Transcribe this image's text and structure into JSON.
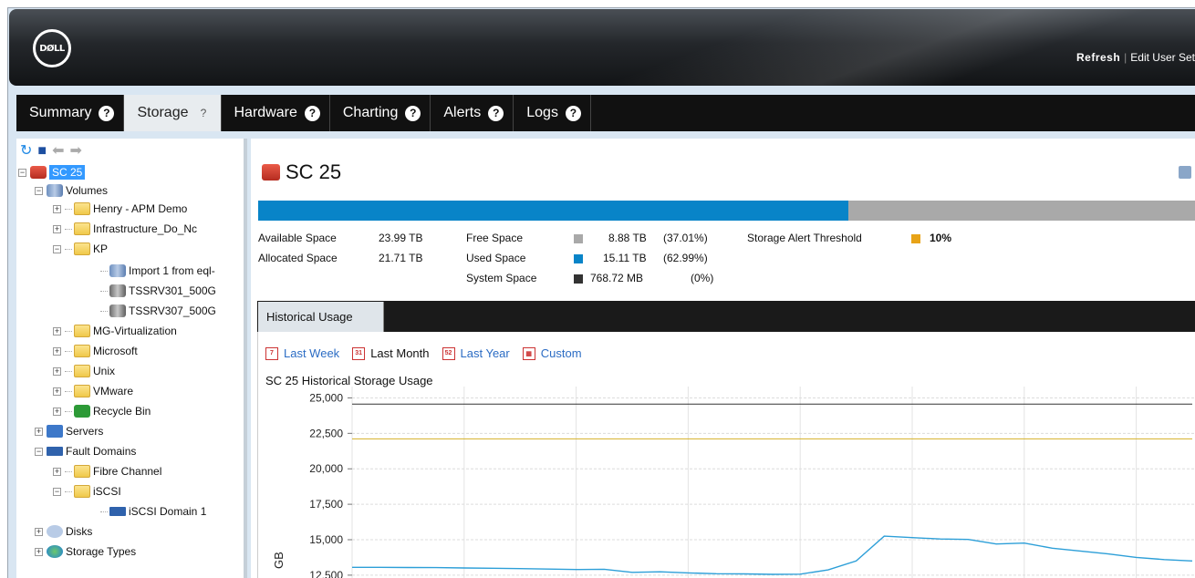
{
  "header": {
    "logo_text": "DØLL",
    "links": [
      "Refresh",
      "Edit User Set"
    ]
  },
  "tabs": [
    {
      "label": "Summary"
    },
    {
      "label": "Storage"
    },
    {
      "label": "Hardware"
    },
    {
      "label": "Charting"
    },
    {
      "label": "Alerts"
    },
    {
      "label": "Logs"
    }
  ],
  "tree": {
    "root": "SC 25",
    "volumes": "Volumes",
    "henry": "Henry - APM Demo",
    "infra": "Infrastructure_Do_Nc",
    "kp": "KP",
    "import": "Import 1 from eql-",
    "tssrv301": "TSSRV301_500G",
    "tssrv307": "TSSRV307_500G",
    "mgvirt": "MG-Virtualization",
    "microsoft": "Microsoft",
    "unix": "Unix",
    "vmware": "VMware",
    "recycle": "Recycle Bin",
    "servers": "Servers",
    "fault": "Fault Domains",
    "fibre": "Fibre Channel",
    "iscsi": "iSCSI",
    "iscsidom": "iSCSI Domain 1",
    "disks": "Disks",
    "storagetypes": "Storage Types"
  },
  "main": {
    "title": "SC 25",
    "used_fraction": 0.6299,
    "available_label": "Available Space",
    "available_value": "23.99 TB",
    "allocated_label": "Allocated Space",
    "allocated_value": "21.71 TB",
    "free_label": "Free Space",
    "free_value": "8.88 TB",
    "free_pct": "(37.01%)",
    "used_label": "Used Space",
    "used_value": "15.11 TB",
    "used_pct": "(62.99%)",
    "system_label": "System Space",
    "system_value": "768.72 MB",
    "system_pct": "(0%)",
    "threshold_label": "Storage Alert Threshold",
    "threshold_value": "10%",
    "colors": {
      "free": "#a9a9a9",
      "used": "#0884c8",
      "system": "#333333",
      "threshold": "#e8a317"
    }
  },
  "history": {
    "tab_label": "Historical Usage",
    "ranges": [
      {
        "label": "Last Week",
        "icon": "7"
      },
      {
        "label": "Last Month",
        "icon": "31"
      },
      {
        "label": "Last Year",
        "icon": "52"
      },
      {
        "label": "Custom",
        "icon": "cal"
      }
    ],
    "chart_title": "SC 25 Historical Storage Usage"
  },
  "chart_data": {
    "type": "line",
    "title": "SC 25 Historical Storage Usage",
    "ylabel": "GB",
    "yticks": [
      "25,000",
      "22,500",
      "20,000",
      "17,500",
      "15,000",
      "12,500"
    ],
    "ylim": [
      12300,
      25800
    ],
    "grid": true,
    "x": [
      0,
      1,
      2,
      3,
      4,
      5,
      6,
      7,
      8,
      9,
      10,
      11,
      12,
      13,
      14,
      15,
      16,
      17,
      18,
      19,
      20,
      21,
      22,
      23,
      24,
      25,
      26,
      27,
      28,
      29,
      30
    ],
    "series": [
      {
        "color": "#333333",
        "values": [
          24566,
          24566,
          24566,
          24566,
          24566,
          24566,
          24566,
          24566,
          24566,
          24566,
          24566,
          24566,
          24566,
          24566,
          24566,
          24566,
          24566,
          24566,
          24566,
          24566,
          24566,
          24566,
          24566,
          24566,
          24566,
          24566,
          24566,
          24566,
          24566,
          24566,
          24566
        ]
      },
      {
        "color": "#d4b126",
        "values": [
          22111,
          22111,
          22111,
          22111,
          22111,
          22111,
          22111,
          22111,
          22111,
          22111,
          22111,
          22111,
          22111,
          22111,
          22111,
          22111,
          22111,
          22111,
          22111,
          22111,
          22111,
          22111,
          22111,
          22111,
          22111,
          22111,
          22111,
          22111,
          22111,
          22111,
          22111
        ]
      },
      {
        "color": "#2d9fd8",
        "values": [
          13050,
          13050,
          13040,
          13030,
          13010,
          12990,
          12960,
          12930,
          12900,
          12920,
          12700,
          12740,
          12660,
          12600,
          12590,
          12560,
          12570,
          12870,
          13500,
          15250,
          15150,
          15050,
          15020,
          14700,
          14760,
          14400,
          14200,
          14000,
          13750,
          13600,
          13500
        ]
      }
    ]
  }
}
